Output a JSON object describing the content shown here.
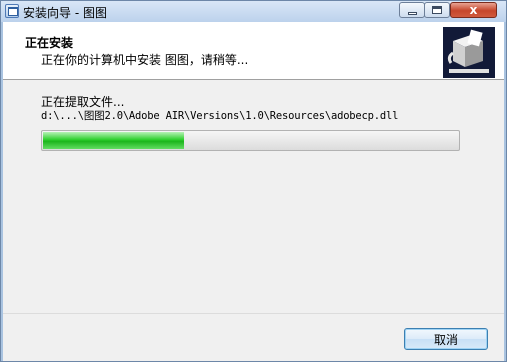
{
  "window": {
    "title": "安装向导 - 图图",
    "close_glyph": "x"
  },
  "header": {
    "title": "正在安装",
    "subtitle": "正在你的计算机中安装 图图，请稍等..."
  },
  "main": {
    "status_text": "正在提取文件...",
    "file_path": "d:\\...\\图图2.0\\Adobe AIR\\Versions\\1.0\\Resources\\adobecp.dll",
    "progress_percent": 34
  },
  "footer": {
    "cancel_label": "取消"
  },
  "colors": {
    "progress_green": "#2ed02e",
    "logo_background": "#121a38"
  },
  "icons": {
    "app": "installer-icon",
    "logo": "installer-box-logo"
  }
}
